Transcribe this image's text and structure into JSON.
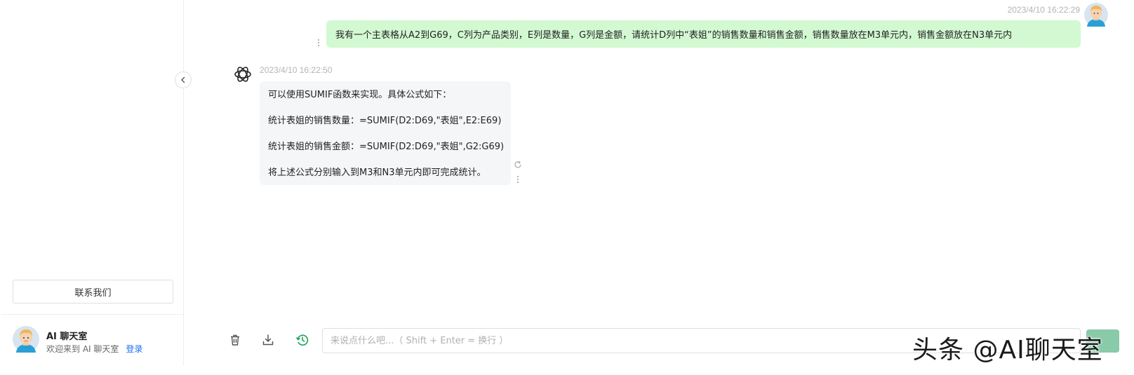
{
  "sidebar": {
    "contact_label": "联系我们",
    "user": {
      "app_name": "AI 聊天室",
      "welcome": "欢迎来到 AI 聊天室",
      "login_label": "登录"
    }
  },
  "chat": {
    "messages": [
      {
        "role": "user",
        "timestamp": "2023/4/10 16:22:29",
        "text": "我有一个主表格从A2到G69，C列为产品类别，E列是数量，G列是金额，请统计D列中“表姐”的销售数量和销售金额，销售数量放在M3单元内，销售金额放在N3单元内"
      },
      {
        "role": "assistant",
        "timestamp": "2023/4/10 16:22:50",
        "lines": [
          "可以使用SUMIF函数来实现。具体公式如下：",
          "统计表姐的销售数量：=SUMIF(D2:D69,\"表姐\",E2:E69)",
          "统计表姐的销售金额：=SUMIF(D2:D69,\"表姐\",G2:G69)",
          "将上述公式分别输入到M3和N3单元内即可完成统计。"
        ]
      }
    ]
  },
  "input": {
    "placeholder": "来说点什么吧...（ Shift + Enter = 换行 ）"
  },
  "icons": {
    "collapse": "chevron-left-icon",
    "delete": "trash-icon",
    "download": "download-icon",
    "history": "history-icon",
    "refresh": "refresh-icon",
    "more": "more-vertical-icon"
  },
  "watermark": "头条 @AI聊天室",
  "colors": {
    "user_bubble": "#d2f9d1",
    "bot_bubble": "#f4f6f8",
    "timestamp": "#b4b4b4",
    "link": "#1e6ff1",
    "history_icon": "#18a058",
    "send_button": "#7cc4a0"
  }
}
